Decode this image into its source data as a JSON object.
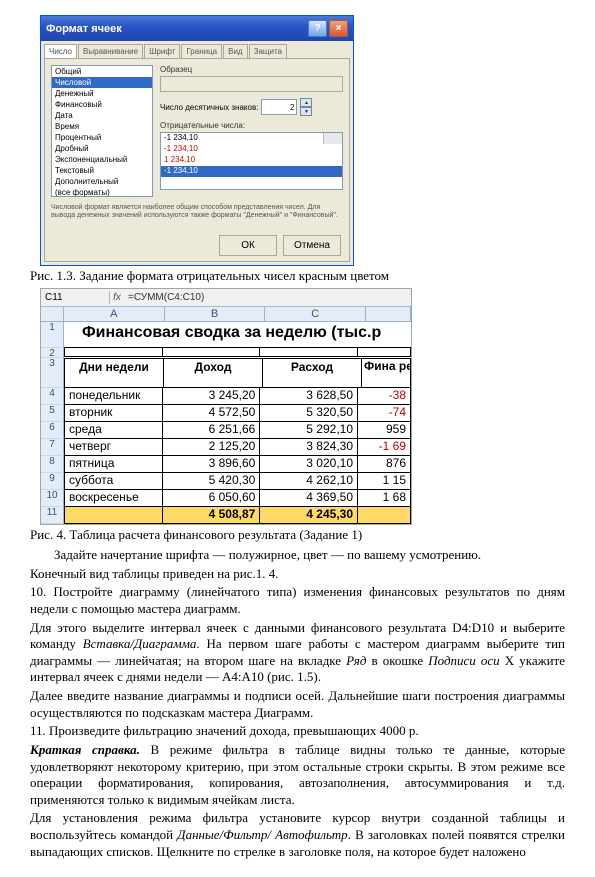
{
  "dialog": {
    "title": "Формат ячеек",
    "help_btn": "?",
    "close_btn": "×",
    "tabs": [
      "Число",
      "Выравнивание",
      "Шрифт",
      "Граница",
      "Вид",
      "Защита"
    ],
    "categories": [
      "Общий",
      "Числовой",
      "Денежный",
      "Финансовый",
      "Дата",
      "Время",
      "Процентный",
      "Дробный",
      "Экспоненциальный",
      "Текстовый",
      "Дополнительный",
      "(все форматы)"
    ],
    "sample_label": "Образец",
    "dec_label": "Число десятичных знаков:",
    "dec_value": "2",
    "neg_label": "Отрицательные числа:",
    "neg_options": [
      {
        "text": "-1 234,10",
        "color": "#000"
      },
      {
        "text": "-1 234,10",
        "color": "#c00"
      },
      {
        "text": "1 234,10",
        "color": "#c00"
      },
      {
        "text": "-1 234,10",
        "color": "#000",
        "sel": true
      }
    ],
    "description": "Числовой формат является наиболее общим способом представления чисел. Для вывода денежных значений используются также форматы \"Денежный\" и \"Финансовый\".",
    "ok": "ОК",
    "cancel": "Отмена"
  },
  "caption1": "Рис. 1.3. Задание формата отрицательных чисел красным цветом",
  "sheet": {
    "namebox_value": "C11",
    "formula": "=СУММ(C4:C10)",
    "columns": [
      "A",
      "B",
      "C"
    ],
    "title": "Финансовая сводка  за неделю (тыс.р",
    "headers": [
      "Дни недели",
      "Доход",
      "Расход",
      "Фина\nрезу"
    ],
    "rows": [
      {
        "n": "4",
        "a": "понедельник",
        "b": "3 245,20",
        "c": "3 628,50",
        "d": "-38",
        "neg": true
      },
      {
        "n": "5",
        "a": "вторник",
        "b": "4 572,50",
        "c": "5 320,50",
        "d": "-74",
        "neg": true
      },
      {
        "n": "6",
        "a": "среда",
        "b": "6 251,66",
        "c": "5 292,10",
        "d": "959",
        "neg": false
      },
      {
        "n": "7",
        "a": "четверг",
        "b": "2 125,20",
        "c": "3 824,30",
        "d": "-1 69",
        "neg": true
      },
      {
        "n": "8",
        "a": "пятница",
        "b": "3 896,60",
        "c": "3 020,10",
        "d": "876",
        "neg": false
      },
      {
        "n": "9",
        "a": "суббота",
        "b": "5 420,30",
        "c": "4 262,10",
        "d": "1 15",
        "neg": false
      },
      {
        "n": "10",
        "a": "воскресенье",
        "b": "6 050,60",
        "c": "4 369,50",
        "d": "1 68",
        "neg": false
      }
    ],
    "totals": {
      "n": "11",
      "a": "",
      "b": "4 508,87",
      "c": "4 245,30",
      "d": ""
    }
  },
  "caption2": "Рис. 4. Таблица расчета финансового результата (Задание 1)",
  "text": {
    "p1": "Задайте начертание шрифта — полужирное, цвет — по вашему усмотрению.",
    "p2": "Конечный вид таблицы приведен на рис.1. 4.",
    "p3a": "10.        Постройте диаграмму (линейчатого типа) изменения финансовых результатов по дням недели с помощью мастера диаграмм.",
    "p4a": "Для этого выделите интервал ячеек с данными финансового результата D4:D10 и выберите команду ",
    "p4b": "Вставка/Диаграмма",
    "p4c": ". На первом шаге работы с мастером диаграмм выберите тип диаграммы — линейчатая; на втором шаге на вкладке ",
    "p4d": "Ряд",
    "p4e": " в окошке ",
    "p4f": "Подписи оси",
    "p4g": " Х укажите интервал ячеек с днями недели — А4:А10 (рис. 1.5).",
    "p5": "Далее введите название диаграммы и подписи осей. Дальнейшие шаги построения диаграммы осуществляются по подсказкам мастера Диаграмм.",
    "p6": "11.           Произведите         фильтрацию         значений         дохода,         превышающих 4000 р.",
    "p7a": "Краткая справка.",
    "p7b": " В режиме фильтра в таблице видны только те данные, которые удовлетворяют некоторому критерию, при этом остальные строки скрыты. В этом режиме все операции форматирования, копирования, автозаполнения, автосуммирования и т.д. применяются только к видимым ячейкам листа.",
    "p8a": "Для установления режима фильтра установите курсор внутри созданной таблицы и воспользуйтесь командой ",
    "p8b": "Данные/Фильтр/ Автофильтр",
    "p8c": ". В заголовках полей появятся стрелки выпадающих списков. Щелкните по стрелке в заголовке поля, на которое будет наложено"
  }
}
